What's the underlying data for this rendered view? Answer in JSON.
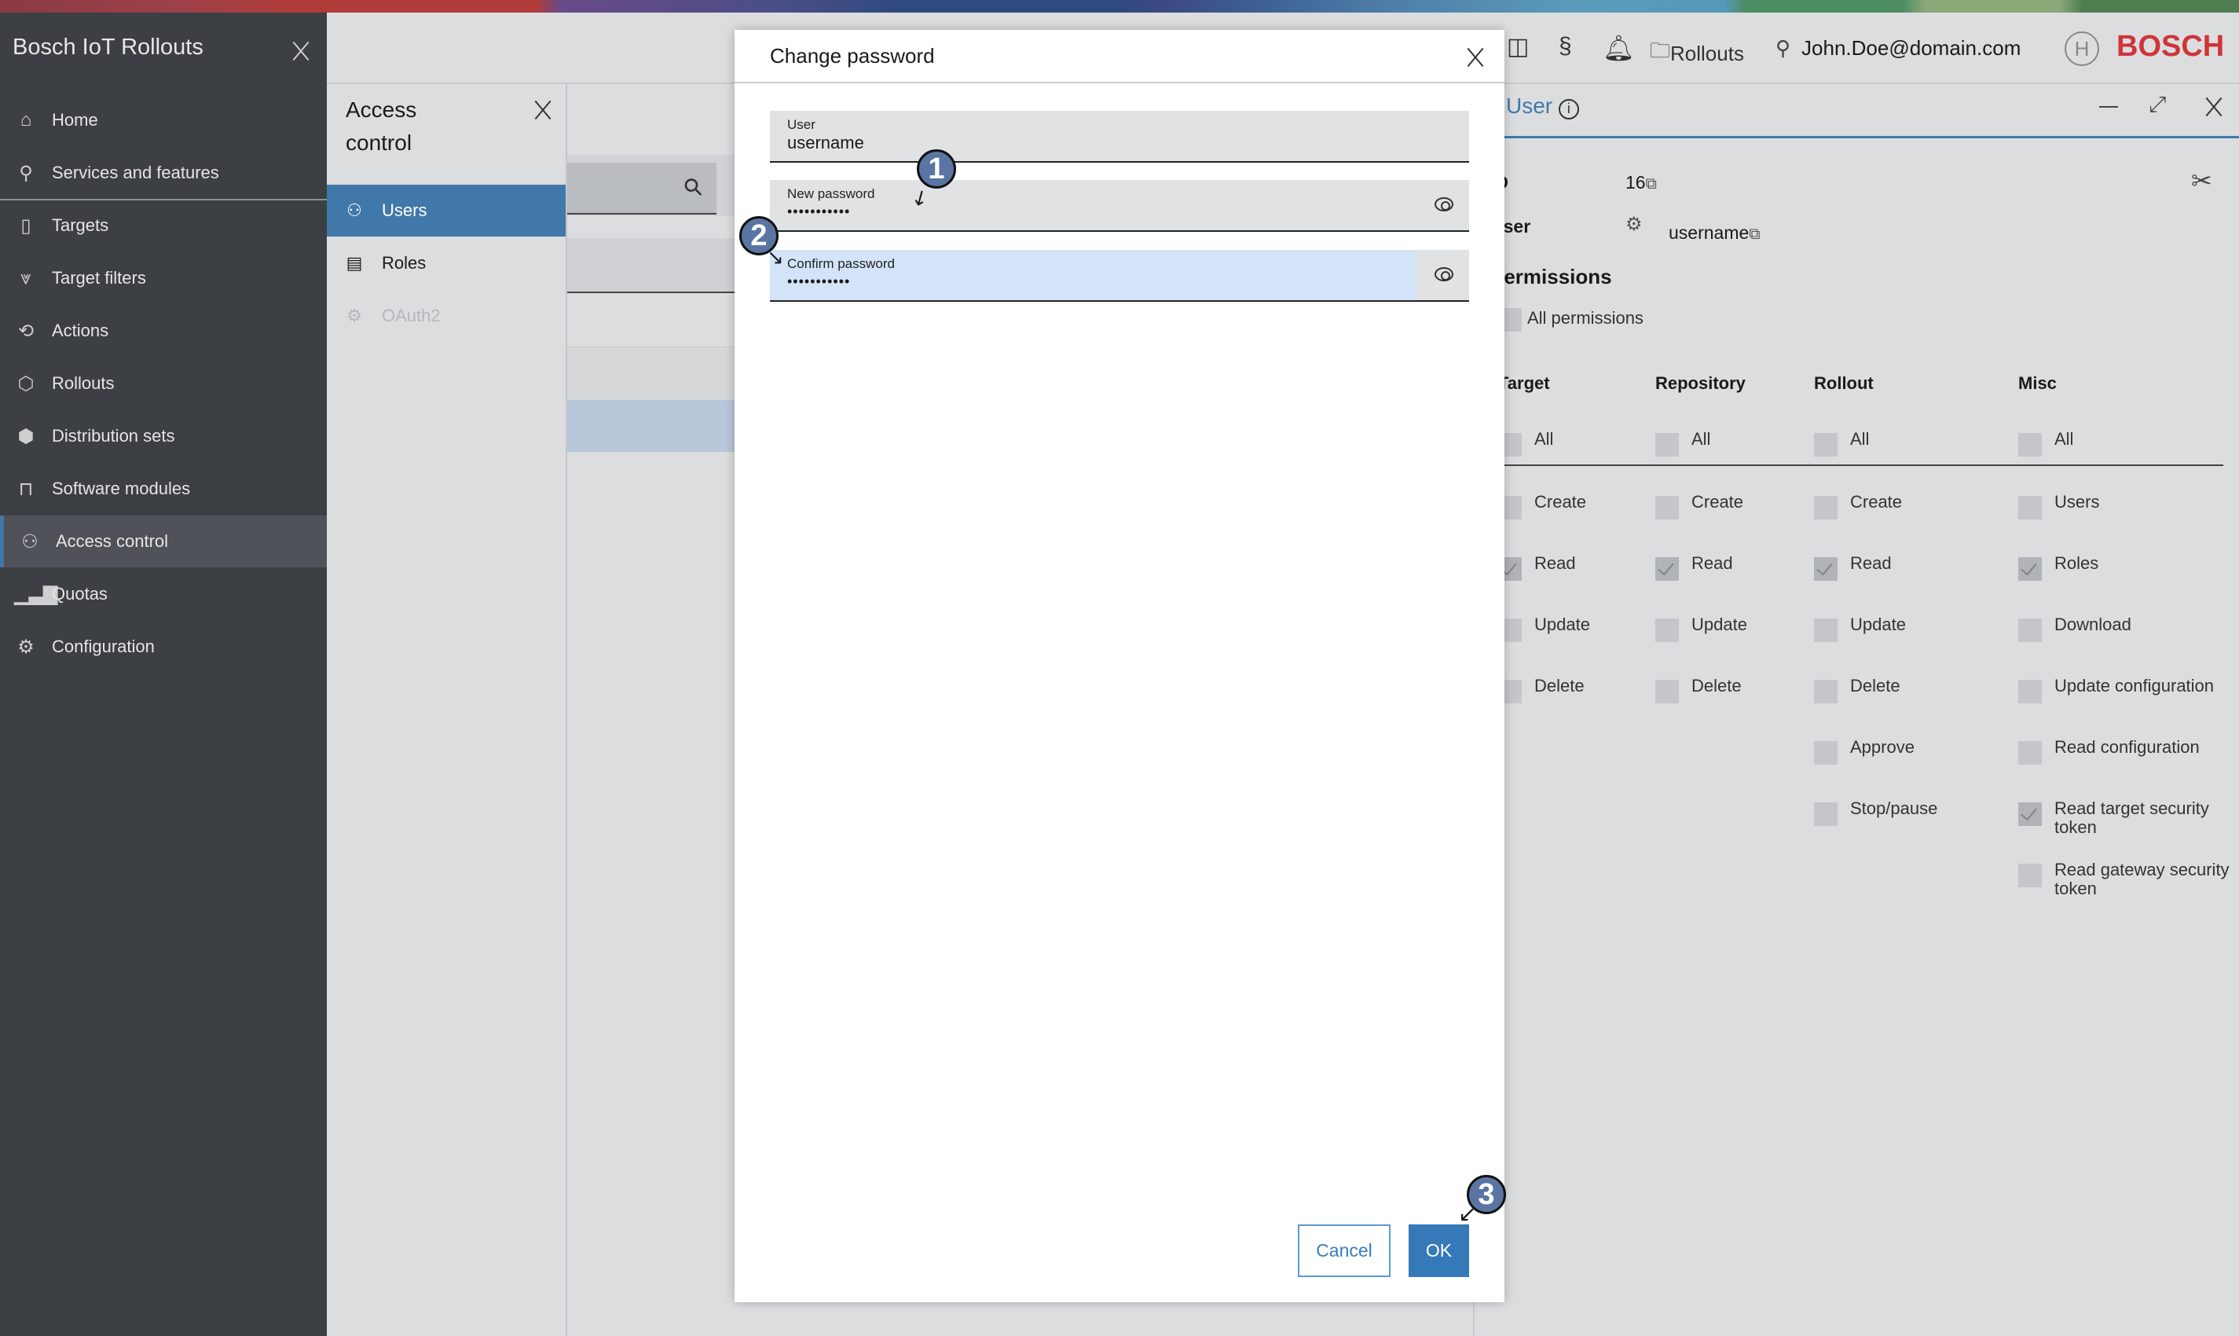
{
  "app": {
    "title": "Bosch IoT Rollouts",
    "brand": "BOSCH",
    "brand_color": "#d0343a",
    "accent": "#4178aa"
  },
  "sidebar": {
    "items": [
      {
        "label": "Home",
        "icon": "home-icon",
        "glyph": "⌂"
      },
      {
        "label": "Services and features",
        "icon": "search-icon",
        "glyph": "⚲"
      },
      {
        "label": "Targets",
        "icon": "target-device-icon",
        "glyph": "▯"
      },
      {
        "label": "Target filters",
        "icon": "filter-icon",
        "glyph": "⩔"
      },
      {
        "label": "Actions",
        "icon": "actions-icon",
        "glyph": "⟲"
      },
      {
        "label": "Rollouts",
        "icon": "package-icon",
        "glyph": "⬡"
      },
      {
        "label": "Distribution sets",
        "icon": "box-icon",
        "glyph": "⬢"
      },
      {
        "label": "Software modules",
        "icon": "modules-icon",
        "glyph": "⊓"
      },
      {
        "label": "Access control",
        "icon": "access-control-icon",
        "glyph": "⚇",
        "active": true
      },
      {
        "label": "Quotas",
        "icon": "bar-chart-icon",
        "glyph": "▁▃▇"
      },
      {
        "label": "Configuration",
        "icon": "gear-icon",
        "glyph": "⚙"
      }
    ]
  },
  "header": {
    "rollouts_label": "Rollouts",
    "user_email": "John.Doe@domain.com",
    "section_glyph": "§"
  },
  "access_control": {
    "title": "Access control",
    "items": [
      {
        "label": "Users",
        "icon": "users-icon",
        "glyph": "⚇"
      },
      {
        "label": "Roles",
        "icon": "roles-icon",
        "glyph": "▤"
      },
      {
        "label": "OAuth2",
        "icon": "oauth-icon",
        "glyph": "⚙"
      }
    ]
  },
  "details": {
    "title": "User",
    "id_label": "ID",
    "id_value": "16",
    "user_label": "User",
    "user_value": "username",
    "permissions_title": "Permissions",
    "all_permissions": "All permissions",
    "columns": [
      {
        "header": "Target",
        "items": [
          {
            "label": "All",
            "checked": false
          },
          {
            "label": "Create",
            "checked": false
          },
          {
            "label": "Read",
            "checked": true
          },
          {
            "label": "Update",
            "checked": false
          },
          {
            "label": "Delete",
            "checked": false
          }
        ]
      },
      {
        "header": "Repository",
        "items": [
          {
            "label": "All",
            "checked": false
          },
          {
            "label": "Create",
            "checked": false
          },
          {
            "label": "Read",
            "checked": true
          },
          {
            "label": "Update",
            "checked": false
          },
          {
            "label": "Delete",
            "checked": false
          }
        ]
      },
      {
        "header": "Rollout",
        "items": [
          {
            "label": "All",
            "checked": false
          },
          {
            "label": "Create",
            "checked": false
          },
          {
            "label": "Read",
            "checked": true
          },
          {
            "label": "Update",
            "checked": false
          },
          {
            "label": "Delete",
            "checked": false
          },
          {
            "label": "Approve",
            "checked": false
          },
          {
            "label": "Stop/pause",
            "checked": false
          }
        ]
      },
      {
        "header": "Misc",
        "items": [
          {
            "label": "All",
            "checked": false
          },
          {
            "label": "Users",
            "checked": false
          },
          {
            "label": "Roles",
            "checked": true
          },
          {
            "label": "Download",
            "checked": false
          },
          {
            "label": "Update configuration",
            "checked": false
          },
          {
            "label": "Read configuration",
            "checked": false
          },
          {
            "label": "Read target security token",
            "checked": true
          },
          {
            "label": "Read gateway security token",
            "checked": false
          }
        ]
      }
    ]
  },
  "modal": {
    "title": "Change password",
    "user_label": "User",
    "user_value": "username",
    "new_password_label": "New password",
    "new_password_value": "•••••••••••",
    "confirm_password_label": "Confirm password",
    "confirm_password_value": "•••••••••••",
    "cancel_label": "Cancel",
    "ok_label": "OK"
  },
  "annotations": [
    "1",
    "2",
    "3"
  ]
}
